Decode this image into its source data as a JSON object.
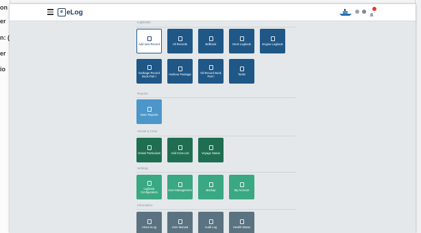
{
  "app": {
    "name": "eLog",
    "logo_letter": "e"
  },
  "background": {
    "left_fragments": [
      "on",
      "er",
      "n: (",
      "er",
      "io"
    ]
  },
  "sections": [
    {
      "title": "Logbooks",
      "tiles": [
        {
          "label": "Add new Record",
          "style": "white",
          "icon": "plus-circle-icon"
        },
        {
          "label": "All Records",
          "style": "blue",
          "icon": "list-icon"
        },
        {
          "label": "Bellbook",
          "style": "blue",
          "icon": "book-icon"
        },
        {
          "label": "Deck Logbook",
          "style": "blue",
          "icon": "book-icon"
        },
        {
          "label": "Engine Logbook",
          "style": "blue",
          "icon": "book-icon"
        },
        {
          "label": "Garbage Record Book Part I",
          "style": "blue",
          "icon": "book-icon"
        },
        {
          "label": "Harbour Passage",
          "style": "blue",
          "icon": "book-icon"
        },
        {
          "label": "Oil Record Book Part I",
          "style": "blue",
          "icon": "book-icon"
        },
        {
          "label": "Tanks",
          "style": "blue",
          "icon": "tank-icon"
        }
      ]
    },
    {
      "title": "Reports",
      "tiles": [
        {
          "label": "Noon Reports",
          "style": "light",
          "icon": "report-icon"
        }
      ]
    },
    {
      "title": "Vessel & Crew",
      "tiles": [
        {
          "label": "Vessel Particulars",
          "style": "green",
          "icon": "ship-icon"
        },
        {
          "label": "Add Crew List",
          "style": "green",
          "icon": "person-icon"
        },
        {
          "label": "Voyage Status",
          "style": "green",
          "icon": "compass-icon"
        }
      ]
    },
    {
      "title": "Settings",
      "tiles": [
        {
          "label": "Logbook Configuration",
          "style": "mint",
          "icon": "settings-icon"
        },
        {
          "label": "User Management",
          "style": "mint",
          "icon": "users-icon"
        },
        {
          "label": "Backup",
          "style": "mint",
          "icon": "backup-icon"
        },
        {
          "label": "My Account",
          "style": "mint",
          "icon": "account-icon"
        }
      ]
    },
    {
      "title": "Information",
      "tiles": [
        {
          "label": "About eLog",
          "style": "slate",
          "icon": "info-icon"
        },
        {
          "label": "User Manual",
          "style": "slate",
          "icon": "manual-icon"
        },
        {
          "label": "Audit Log",
          "style": "slate",
          "icon": "audit-icon"
        },
        {
          "label": "Health Status",
          "style": "slate",
          "icon": "pulse-icon"
        }
      ]
    }
  ],
  "colors": {
    "blue": "#1f5787",
    "light": "#4d96c9",
    "green": "#1f6e52",
    "mint": "#3aa882",
    "slate": "#5b7280",
    "badge": "#e53935"
  }
}
